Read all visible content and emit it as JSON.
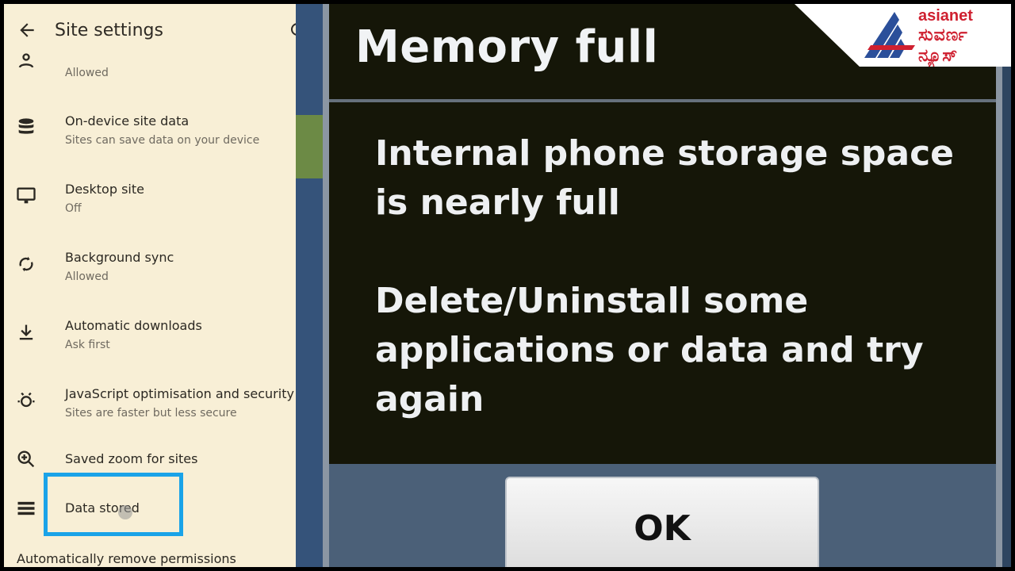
{
  "header": {
    "title": "Site settings"
  },
  "settings": [
    {
      "label": "",
      "sublabel": "Allowed",
      "icon": "notifications-person-icon"
    },
    {
      "label": "On-device site data",
      "sublabel": "Sites can save data on your device",
      "icon": "database-icon"
    },
    {
      "label": "Desktop site",
      "sublabel": "Off",
      "icon": "monitor-icon"
    },
    {
      "label": "Background sync",
      "sublabel": "Allowed",
      "icon": "sync-icon"
    },
    {
      "label": "Automatic downloads",
      "sublabel": "Ask first",
      "icon": "download-icon"
    },
    {
      "label": "JavaScript optimisation and security",
      "sublabel": "Sites are faster but less secure",
      "icon": "bug-shield-icon"
    },
    {
      "label": "Saved zoom for sites",
      "sublabel": "",
      "icon": "zoom-icon"
    },
    {
      "label": "Data stored",
      "sublabel": "",
      "icon": "storage-list-icon"
    }
  ],
  "footer_text": "Automatically remove permissions",
  "dialog": {
    "title": "Memory full",
    "message_lines_1": [
      "Internal phone storage space",
      "is nearly full"
    ],
    "message_lines_2": [
      "Delete/Uninstall some",
      "applications or data and try",
      "again"
    ],
    "ok_label": "OK"
  },
  "logo": {
    "name": "asianet",
    "script": "ಸುವರ್ಣ ನ್ಯೂಸ್"
  },
  "colors": {
    "highlight": "#1aa3e8",
    "panel_bg": "#f8efd6",
    "dialog_bg": "#151608",
    "logo_red": "#cf2030"
  }
}
